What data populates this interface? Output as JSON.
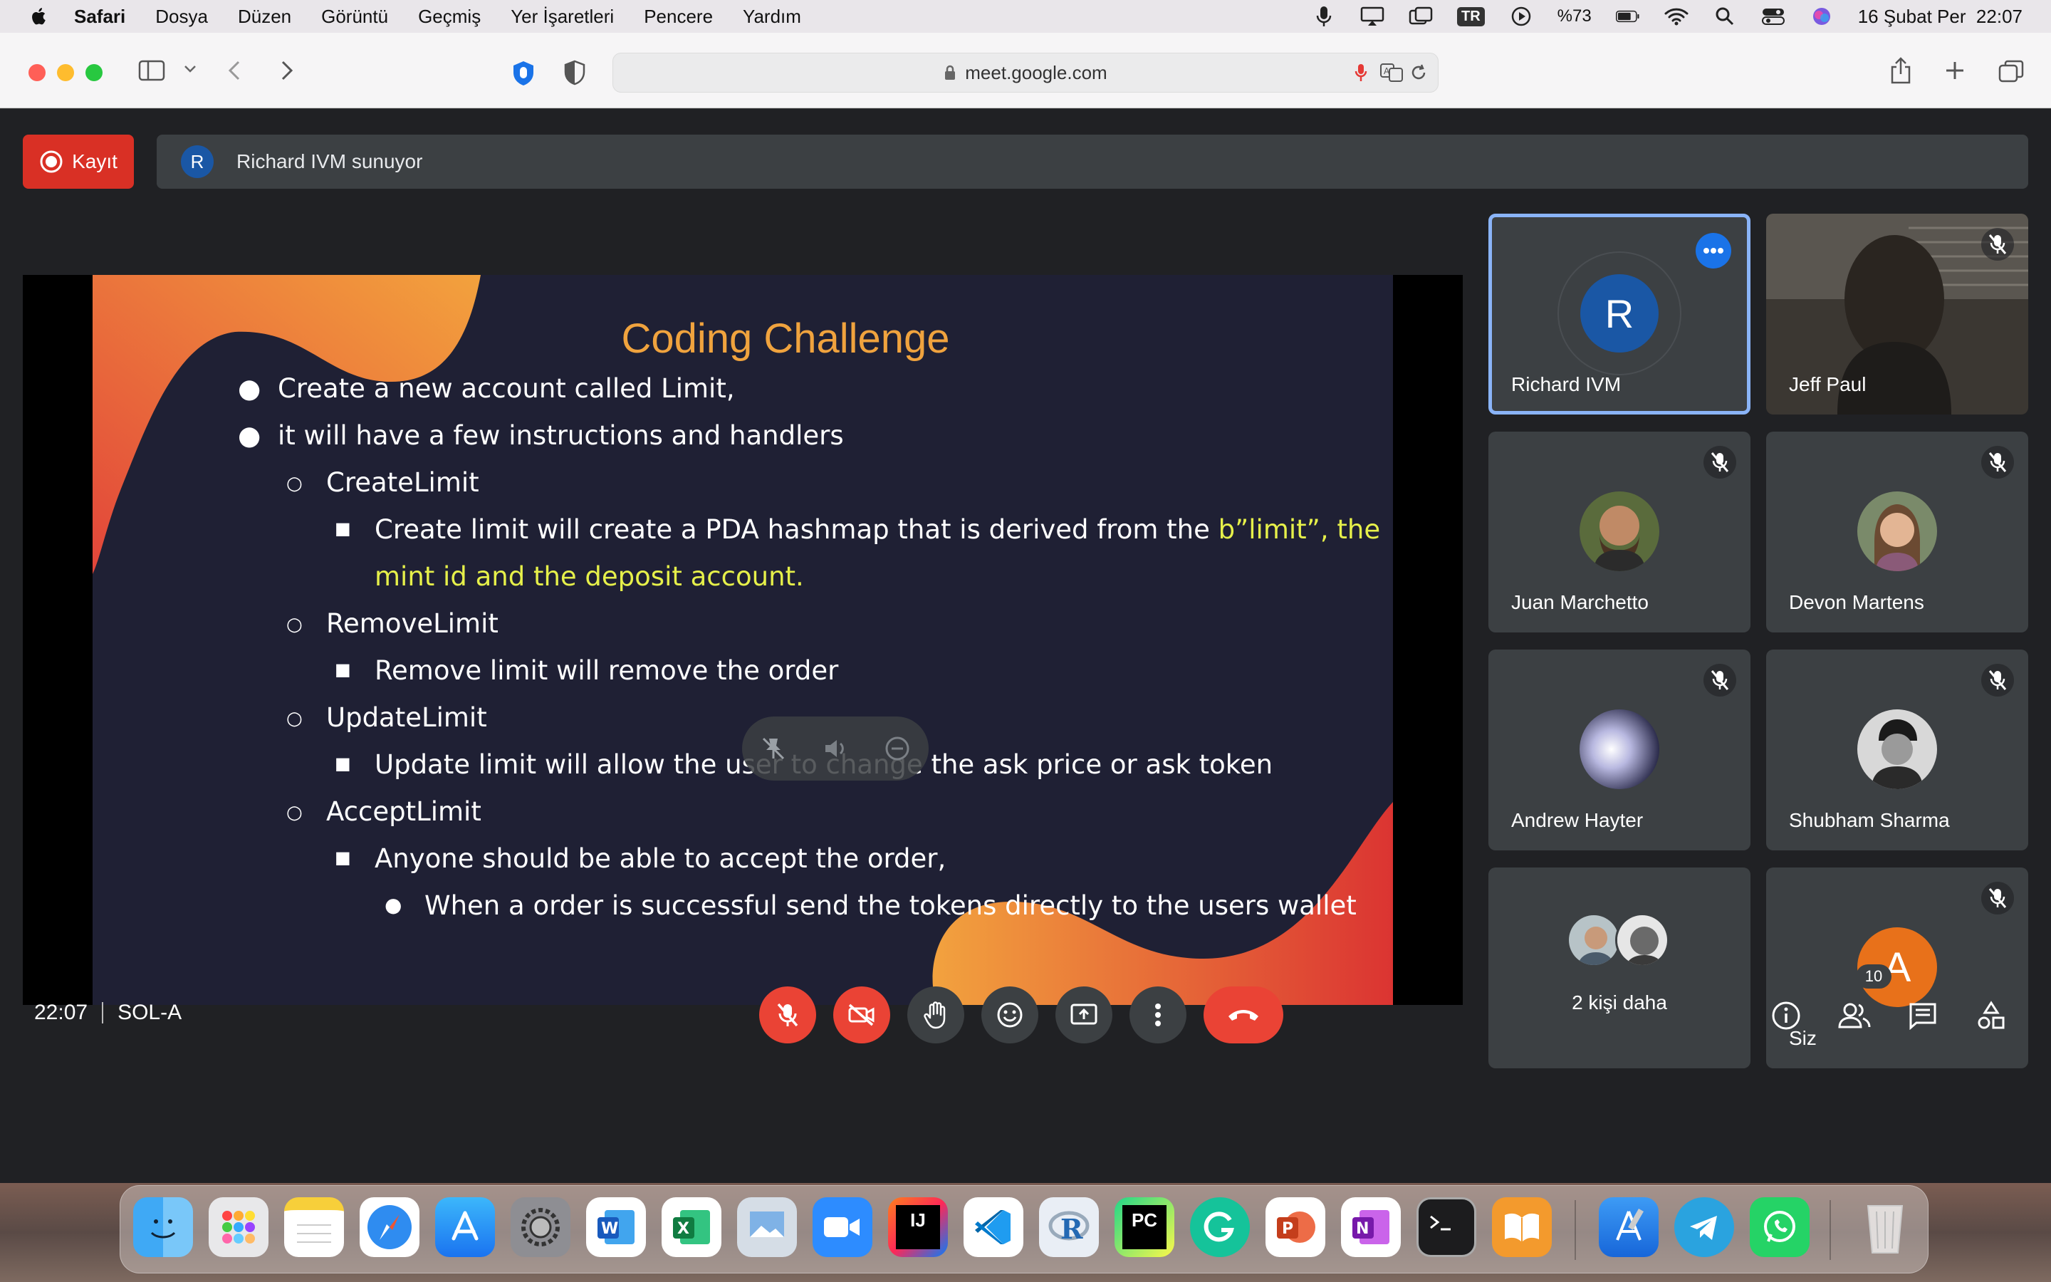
{
  "menubar": {
    "app_name": "Safari",
    "items": [
      "Dosya",
      "Düzen",
      "Görüntü",
      "Geçmiş",
      "Yer İşaretleri",
      "Pencere",
      "Yardım"
    ],
    "input_lang": "TR",
    "battery": "%73",
    "datetime": "16 Şubat Per  22:07"
  },
  "browser": {
    "url": "meet.google.com"
  },
  "meet": {
    "record_label": "Kayıt",
    "presenter_initial": "R",
    "presenter_text": "Richard IVM sunuyor",
    "slide": {
      "title": "Coding Challenge",
      "lines": [
        "Create a new account called Limit,",
        "it will have a few instructions and handlers",
        "CreateLimit",
        "Create limit will create a PDA hashmap that is derived from the ",
        "b”limit”, the",
        "mint id and the deposit account.",
        "RemoveLimit",
        "Remove limit will remove the order",
        "UpdateLimit",
        "Update limit will allow the user to change the ask price or ask token",
        "AcceptLimit",
        "Anyone should be able to accept the order,",
        "When a order is successful send the tokens directly to the users wallet"
      ]
    },
    "participants": [
      {
        "name": "Richard IVM",
        "initial": "R"
      },
      {
        "name": "Jeff Paul"
      },
      {
        "name": "Juan Marchetto"
      },
      {
        "name": "Devon Martens"
      },
      {
        "name": "Andrew Hayter"
      },
      {
        "name": "Shubham Sharma"
      },
      {
        "name": "2 kişi daha"
      },
      {
        "name": "Siz",
        "initial": "A"
      }
    ],
    "time": "22:07",
    "meeting_name": "SOL-A",
    "participant_count": "10"
  },
  "colors": {
    "meet_bg": "#202124",
    "tile_bg": "#3c4043",
    "danger": "#ea4335",
    "accent_orange": "#f0a33e",
    "highlight_yellow": "#e6f04a",
    "active_tile_border": "#8ab4f8"
  },
  "dock": {
    "apps": [
      "finder-icon",
      "launchpad-icon",
      "notes-icon",
      "safari-icon",
      "app-store-icon",
      "system-settings-icon",
      "word-icon",
      "excel-icon",
      "preview-icon",
      "zoom-icon",
      "intellij-icon",
      "vscode-icon",
      "r-icon",
      "pycharm-icon",
      "grammarly-icon",
      "powerpoint-icon",
      "onenote-icon",
      "terminal-icon",
      "books-icon",
      "xcode-icon",
      "telegram-icon",
      "whatsapp-icon",
      "trash-icon"
    ]
  }
}
